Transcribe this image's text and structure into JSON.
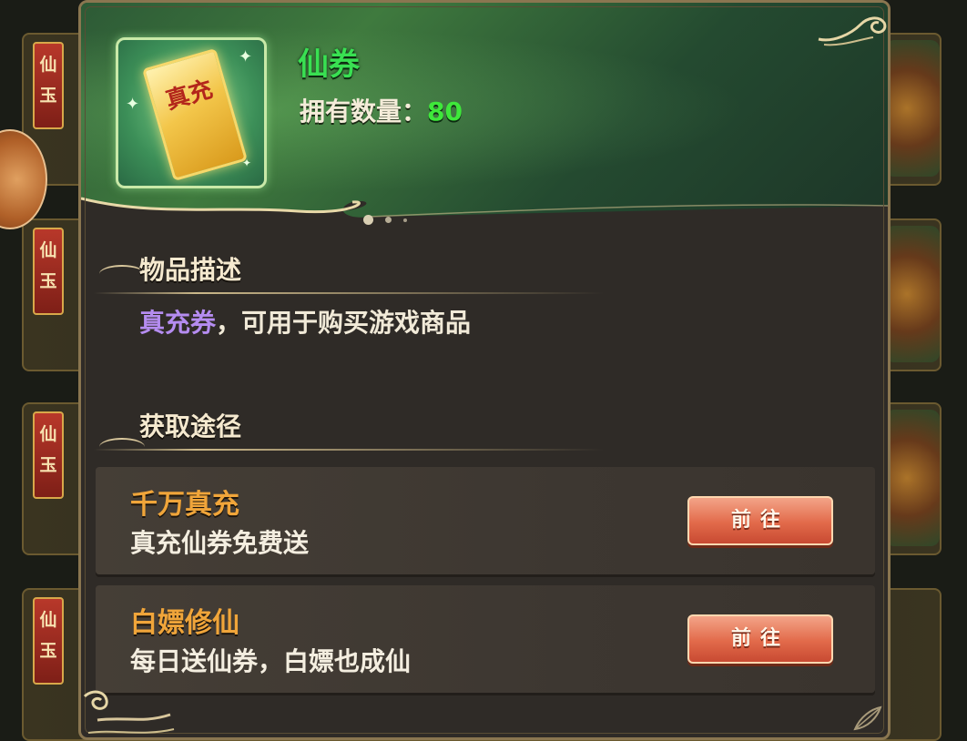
{
  "item": {
    "name": "仙券",
    "ticket_text": "真充",
    "owned_label": "拥有数量：",
    "owned_count": "80"
  },
  "background": {
    "card_tag": "仙玉"
  },
  "description": {
    "title": "物品描述",
    "highlight": "真充券",
    "text": "，可用于购买游戏商品"
  },
  "acquire": {
    "title": "获取途径",
    "routes": [
      {
        "title": "千万真充",
        "subtitle": "真充仙券免费送",
        "button": "前往"
      },
      {
        "title": "白嫖修仙",
        "subtitle": "每日送仙券，白嫖也成仙",
        "button": "前往"
      }
    ]
  },
  "colors": {
    "item_name": "#39e052",
    "owned_count": "#3ee83a",
    "route_title": "#f0a53a",
    "highlight": "#b58cf0",
    "button": "#e26a4a"
  }
}
